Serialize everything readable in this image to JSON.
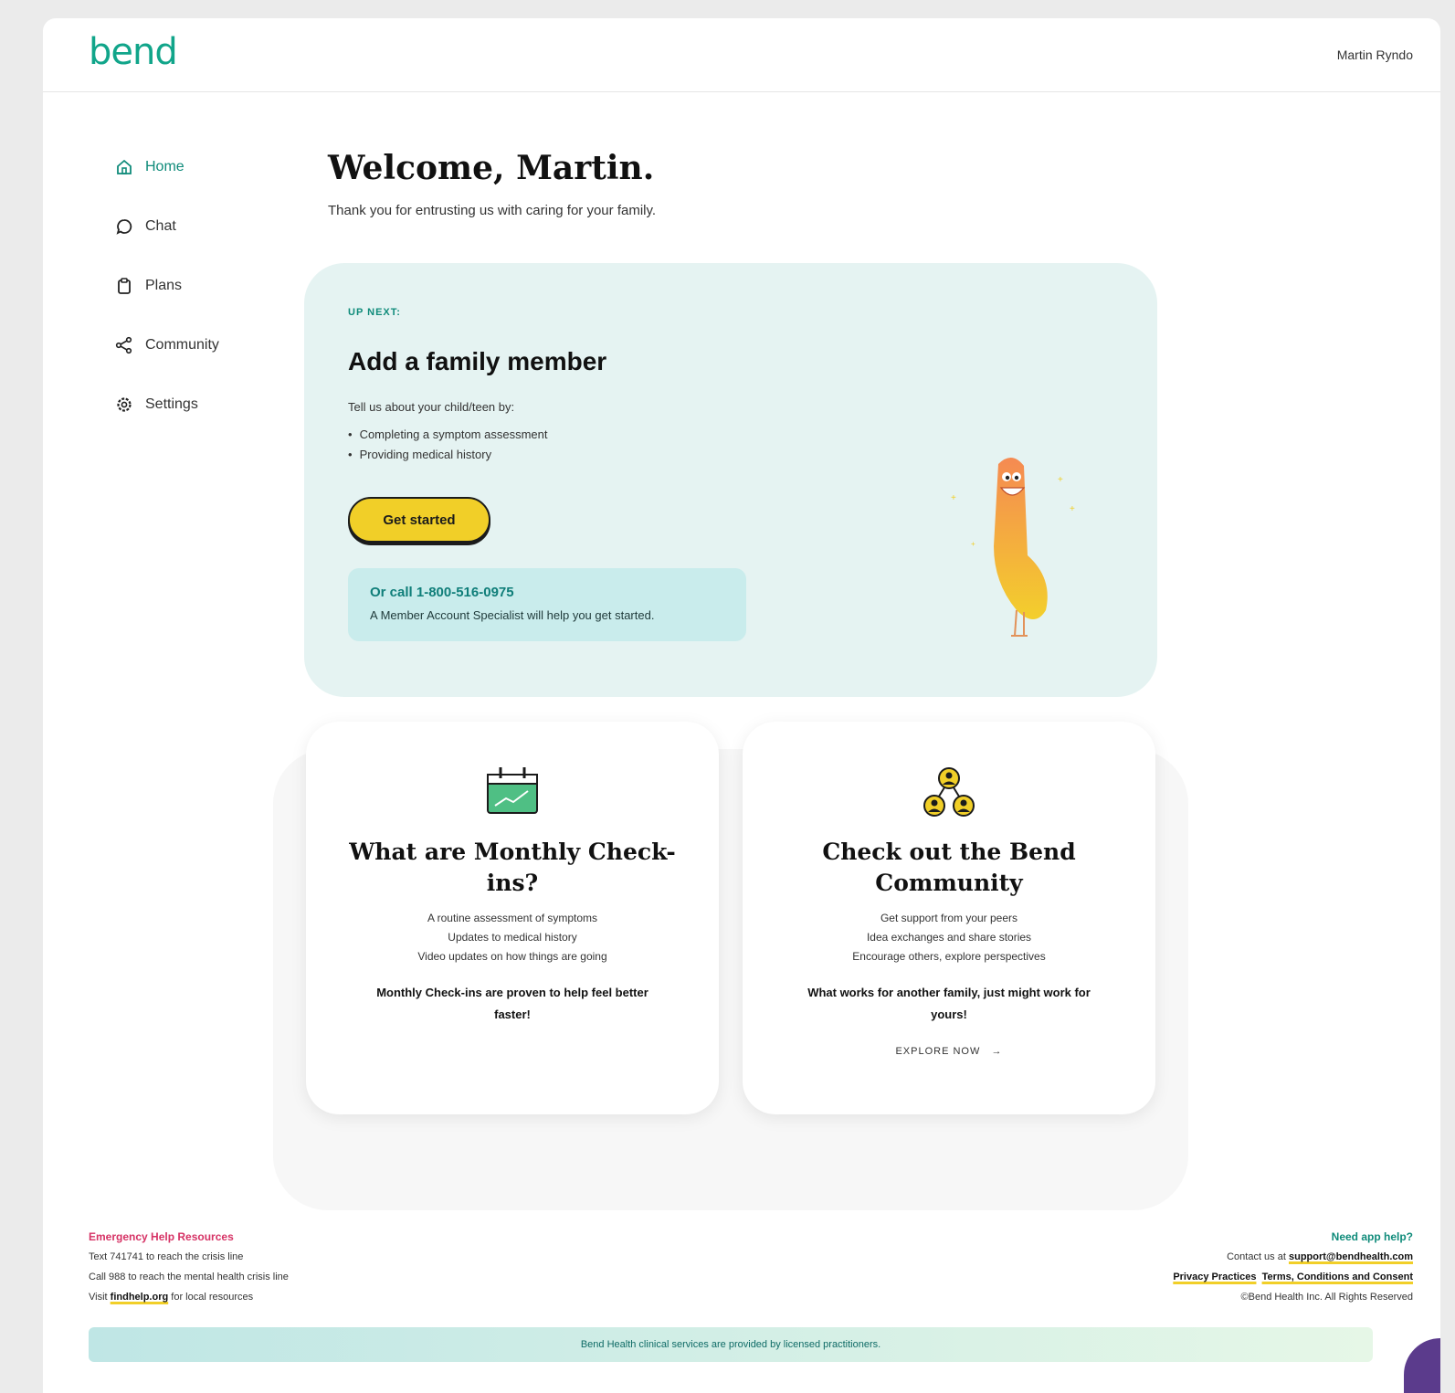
{
  "app": {
    "logo": "bend",
    "user_name": "Martin Ryndo"
  },
  "sidebar": {
    "items": [
      {
        "label": "Home",
        "icon": "home-icon"
      },
      {
        "label": "Chat",
        "icon": "chat-icon"
      },
      {
        "label": "Plans",
        "icon": "clipboard-icon"
      },
      {
        "label": "Community",
        "icon": "share-icon"
      },
      {
        "label": "Settings",
        "icon": "gear-icon"
      }
    ]
  },
  "main": {
    "title": "Welcome, Martin.",
    "subtitle": "Thank you for entrusting us with caring for your family."
  },
  "upnext": {
    "label": "UP NEXT:",
    "title": "Add a family member",
    "intro": "Tell us about your child/teen by:",
    "bullets": [
      "Completing a symptom assessment",
      "Providing medical history"
    ],
    "button": "Get started",
    "call_title": "Or call 1-800-516-0975",
    "call_sub": "A Member Account Specialist will help you get started."
  },
  "cards": {
    "checkins": {
      "title": "What are Monthly Check-ins?",
      "lines": [
        "A routine assessment of symptoms",
        "Updates to medical history",
        "Video updates on how things are going"
      ],
      "bold": "Monthly Check-ins are proven to help feel better faster!"
    },
    "community": {
      "title": "Check out the Bend Community",
      "lines": [
        "Get support from your peers",
        "Idea exchanges and share stories",
        "Encourage others, explore perspectives"
      ],
      "bold": "What works for another family, just might work for yours!",
      "link": "EXPLORE NOW"
    }
  },
  "footer": {
    "emergency_title": "Emergency Help Resources",
    "emergency_lines": [
      "Text 741741 to reach the crisis line",
      "Call 988 to reach the mental health crisis line"
    ],
    "visit_prefix": "Visit",
    "visit_link": "findhelp.org",
    "visit_suffix": "for local resources",
    "help_title": "Need app help?",
    "contact_prefix": "Contact us at",
    "contact_email": "support@bendhealth.com",
    "privacy": "Privacy Practices",
    "terms": "Terms, Conditions and Consent",
    "copyright": "©Bend Health Inc. All Rights Reserved",
    "banner": "Bend Health clinical services are provided by licensed practitioners."
  },
  "colors": {
    "brand": "#11a58a",
    "accent_yellow": "#f1cf28",
    "emergency": "#d63265"
  }
}
